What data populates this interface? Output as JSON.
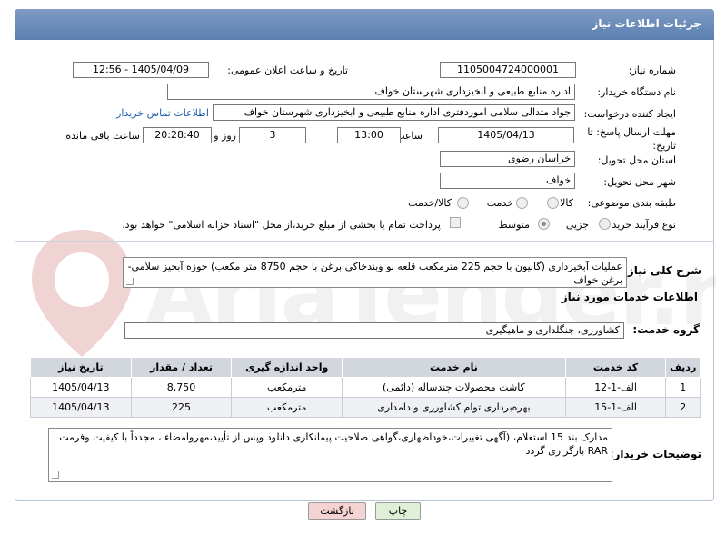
{
  "header": {
    "title": "جزئیات اطلاعات نیاز"
  },
  "form": {
    "need_number_label": "شماره نیاز:",
    "need_number": "1105004724000001",
    "announce_label": "تاریخ و ساعت اعلان عمومی:",
    "announce_value": "1405/04/09 - 12:56",
    "buyer_label": "نام دستگاه خریدار:",
    "buyer_value": "اداره منابع طبیعی و ابخیزداری شهرستان خواف",
    "creator_label": "ایجاد کننده درخواست:",
    "creator_value": "جواد متدالی سلامی اموردفتری اداره منابع طبیعی و ابخیزداری شهرستان خواف",
    "contact_link": "اطلاعات تماس خریدار",
    "deadline_label": "مهلت ارسال پاسخ: تا تاریخ:",
    "deadline_date": "1405/04/13",
    "time_label": "ساعت",
    "deadline_time": "13:00",
    "days_value": "3",
    "days_label": "روز و",
    "remaining_time": "20:28:40",
    "remaining_label": "ساعت باقی مانده",
    "province_label": "استان محل تحویل:",
    "province_value": "خراسان رضوی",
    "city_label": "شهر محل تحویل:",
    "city_value": "خواف",
    "category_label": "طبقه بندی موضوعی:",
    "category_options": [
      "کالا",
      "خدمت",
      "کالا/خدمت"
    ],
    "process_label": "نوع فرآیند خرید :",
    "process_options": [
      "جزیی",
      "متوسط"
    ],
    "payment_note": "پرداخت تمام یا بخشی از مبلغ خرید،از محل \"اسناد خزانه اسلامی\" خواهد بود."
  },
  "description": {
    "label": "شرح کلی نیاز:",
    "text": "عملیات آبخیزداری (گابیون با حجم 225 مترمکعب قلعه نو وبندخاکی برغن با حجم 8750 متر مکعب) حوزه آبخیز سلامی-برغن خواف"
  },
  "services": {
    "section_title": "اطلاعات خدمات مورد نیاز",
    "group_label": "گروه خدمت:",
    "group_value": "کشاورزی، جنگلداری و ماهیگیری",
    "columns": [
      "ردیف",
      "کد خدمت",
      "نام خدمت",
      "واحد اندازه گیری",
      "تعداد / مقدار",
      "تاریخ نیاز"
    ],
    "rows": [
      [
        "1",
        "الف-1-12",
        "کاشت محصولات چندساله (دائمی)",
        "مترمکعب",
        "8,750",
        "1405/04/13"
      ],
      [
        "2",
        "الف-1-15",
        "بهره‌برداری توام کشاورزی و دامداری",
        "مترمکعب",
        "225",
        "1405/04/13"
      ]
    ]
  },
  "buyer_notes": {
    "label": "توضیحات خریدار:",
    "text": "مدارک بند 15 استعلام، (آگهی تغییرات،خوداظهاری،گواهی صلاحیت پیمانکاری دانلود وپس از تأیید،مهروامضاء ، مجدداً با کیفیت وفرمت RAR بارگزاری گردد"
  },
  "buttons": {
    "print": "چاپ",
    "back": "بازگشت"
  },
  "watermark": {
    "text": "AriaTender.net"
  },
  "colors": {
    "header": "#6a8cbb",
    "link": "#1b5fae",
    "back_button": "#f6d3d3",
    "print_button": "#dff0d6"
  }
}
